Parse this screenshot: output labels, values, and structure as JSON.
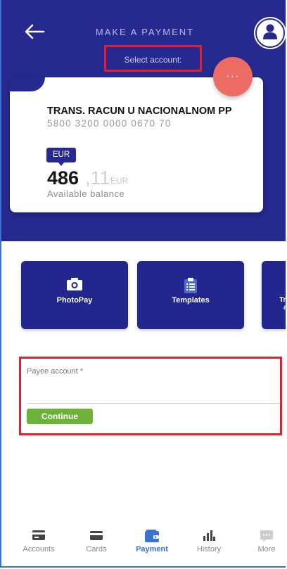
{
  "header": {
    "title": "MAKE A PAYMENT",
    "select_account_label": "Select account:"
  },
  "account": {
    "name": "TRANS. RACUN U NACIONALNOM PP",
    "number": "5800 3200 0000 0670 70",
    "currency_badge": "EUR",
    "balance_whole": "486",
    "balance_decimal": ",11",
    "balance_currency": "EUR",
    "balance_label": "Available balance"
  },
  "more_button": {
    "label": "···"
  },
  "tiles": [
    {
      "label": "PhotoPay",
      "icon": "camera-icon"
    },
    {
      "label": "Templates",
      "icon": "clipboard-icon"
    },
    {
      "label": "Tra\na",
      "icon": "transfer-icon"
    }
  ],
  "form": {
    "payee_label": "Payee account *",
    "payee_value": "",
    "continue_label": "Continue"
  },
  "bottom_nav": [
    {
      "label": "Accounts",
      "icon": "wallet-card-icon",
      "active": false
    },
    {
      "label": "Cards",
      "icon": "credit-card-icon",
      "active": false
    },
    {
      "label": "Payment",
      "icon": "payment-icon",
      "active": true
    },
    {
      "label": "History",
      "icon": "bar-chart-icon",
      "active": false
    },
    {
      "label": "More",
      "icon": "chat-dots-icon",
      "active": false
    }
  ],
  "colors": {
    "header_bg": "#26298f",
    "tile_bg": "#22268e",
    "fab": "#ec6b62",
    "continue": "#6bb236",
    "highlight_box": "#e0202a",
    "nav_active": "#3a73d6"
  }
}
